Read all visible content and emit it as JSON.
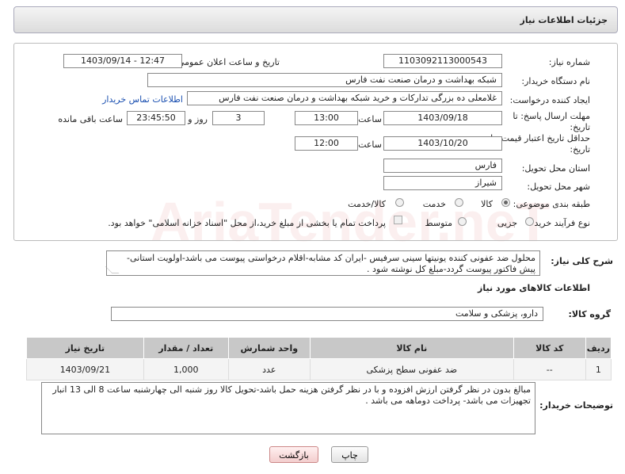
{
  "header": {
    "title": "جزئیات اطلاعات نیاز"
  },
  "form": {
    "need_number_label": "شماره نیاز:",
    "need_number": "1103092113000543",
    "announce_label": "تاریخ و ساعت اعلان عمومی:",
    "announce_value": "1403/09/14 - 12:47",
    "buyer_label": "نام دستگاه خریدار:",
    "buyer_value": "شبکه بهداشت و درمان صنعت نفت فارس",
    "creator_label": "ایجاد کننده درخواست:",
    "creator_value": "غلامعلی ده بزرگی تدارکات و خرید شبکه بهداشت و درمان صنعت نفت فارس",
    "contact_link": "اطلاعات تماس خریدار",
    "deadline_label_1": "مهلت ارسال پاسخ: تا",
    "deadline_label_2": "تاریخ:",
    "deadline_date": "1403/09/18",
    "time_label": "ساعت",
    "deadline_time": "13:00",
    "days_value": "3",
    "days_label": "روز و",
    "remaining_value": "23:45:50",
    "remaining_label": "ساعت باقی مانده",
    "validity_label_1": "حداقل تاریخ اعتبار قیمت: تا",
    "validity_label_2": "تاریخ:",
    "validity_date": "1403/10/20",
    "validity_time": "12:00",
    "province_label": "استان محل تحویل:",
    "province_value": "فارس",
    "city_label": "شهر محل تحویل:",
    "city_value": "شیراز",
    "category_label": "طبقه بندی موضوعی:",
    "category_options": [
      "کالا",
      "خدمت",
      "کالا/خدمت"
    ],
    "process_label": "نوع فرآیند خرید :",
    "process_options": [
      "جزیی",
      "متوسط"
    ],
    "payment_note": "پرداخت تمام یا بخشی از مبلغ خرید،از محل \"اسناد خزانه اسلامی\" خواهد بود."
  },
  "description": {
    "label": "شرح کلی نیاز:",
    "text": "محلول ضد عفونی کننده یونیتها سینی سرفیس -ایران کد مشابه-اقلام درخواستی پیوست می باشد-اولویت استانی-پیش فاکتور پیوست گردد-مبلغ کل نوشته شود ."
  },
  "goods": {
    "section_title": "اطلاعات کالاهای مورد نیاز",
    "group_label": "گروه کالا:",
    "group_value": "دارو، پزشکی و سلامت",
    "columns": [
      "ردیف",
      "کد کالا",
      "نام کالا",
      "واحد شمارش",
      "تعداد / مقدار",
      "تاریخ نیاز"
    ],
    "rows": [
      [
        "1",
        "--",
        "ضد عفونی سطح پزشکی",
        "عدد",
        "1,000",
        "1403/09/21"
      ]
    ]
  },
  "buyer_notes": {
    "label": "توضیحات خریدار:",
    "text": "مبالغ بدون در نظر گرفتن ارزش افزوده و با در نظر گرفتن هزینه حمل باشد-تحویل کالا روز شنبه الی چهارشنبه ساعت 8 الی 13 انبار تجهیزات می باشد- پرداخت دوماهه می باشد ."
  },
  "buttons": {
    "print": "چاپ",
    "back": "بازگشت"
  },
  "watermark": "AriaTender.neT"
}
